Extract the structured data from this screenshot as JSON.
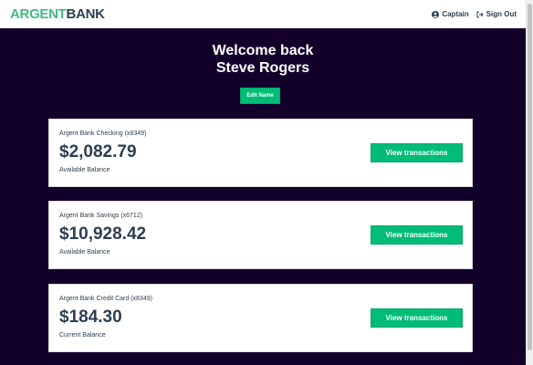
{
  "header": {
    "logo_part1": "ARGENT",
    "logo_part2": "BANK",
    "user_name": "Captain",
    "sign_out_label": "Sign Out"
  },
  "welcome": {
    "line1": "Welcome back",
    "line2": "Steve Rogers",
    "edit_button_label": "Edit Name"
  },
  "accounts": [
    {
      "title": "Argent Bank Checking (x8349)",
      "amount": "$2,082.79",
      "description": "Available Balance",
      "button_label": "View transactions"
    },
    {
      "title": "Argent Bank Savings (x6712)",
      "amount": "$10,928.42",
      "description": "Available Balance",
      "button_label": "View transactions"
    },
    {
      "title": "Argent Bank Credit Card (x8349)",
      "amount": "$184.30",
      "description": "Current Balance",
      "button_label": "View transactions"
    }
  ],
  "colors": {
    "background": "#12002b",
    "accent": "#00bc77",
    "logo_accent": "#42b983",
    "text": "#2c3e50"
  },
  "icons": {
    "user": "user-circle-icon",
    "sign_out": "sign-out-icon"
  }
}
